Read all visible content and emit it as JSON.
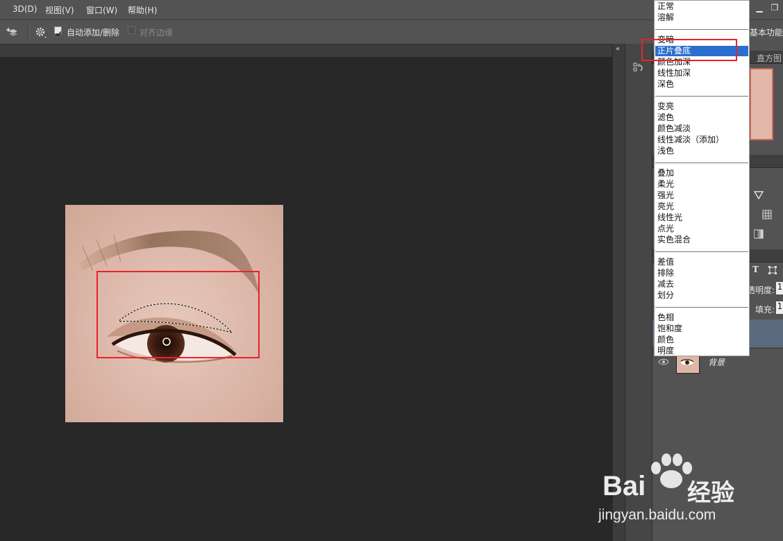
{
  "menu": {
    "items": [
      "3D(D)",
      "视图(V)",
      "窗口(W)",
      "帮助(H)"
    ]
  },
  "options_bar": {
    "auto_add_delete_label": "自动添加/删除",
    "auto_add_delete_checked": true,
    "align_edges_label": "对齐边缘",
    "align_edges_checked": false,
    "workspace_label": "基本功能"
  },
  "panels": {
    "histogram_tab": "直方图",
    "opacity_label": "透明度:",
    "opacity_value": "1",
    "fill_label": "填充:",
    "fill_value": "1",
    "background_layer_name": "背景"
  },
  "blend_mode_dropdown": {
    "groups": [
      [
        "正常",
        "溶解"
      ],
      [
        "变暗",
        "正片叠底",
        "颜色加深",
        "线性加深",
        "深色"
      ],
      [
        "变亮",
        "滤色",
        "颜色减淡",
        "线性减淡（添加）",
        "浅色"
      ],
      [
        "叠加",
        "柔光",
        "强光",
        "亮光",
        "线性光",
        "点光",
        "实色混合"
      ],
      [
        "差值",
        "排除",
        "减去",
        "划分"
      ],
      [
        "色相",
        "饱和度",
        "颜色",
        "明度"
      ]
    ],
    "selected": "正片叠底"
  },
  "watermark": {
    "brand_left": "Bai",
    "brand_right": "经验",
    "url": "jingyan.baidu.com"
  },
  "icons": [
    "layers-arrange-icon",
    "gear-icon",
    "history-icon",
    "triangle-down-icon",
    "grid-icon",
    "gradient-icon",
    "text-icon",
    "transform-icon",
    "eye-icon",
    "panel-collapse-icon"
  ],
  "colors": {
    "selection_blue": "#2b6fce",
    "highlight_red": "#e8232b"
  }
}
